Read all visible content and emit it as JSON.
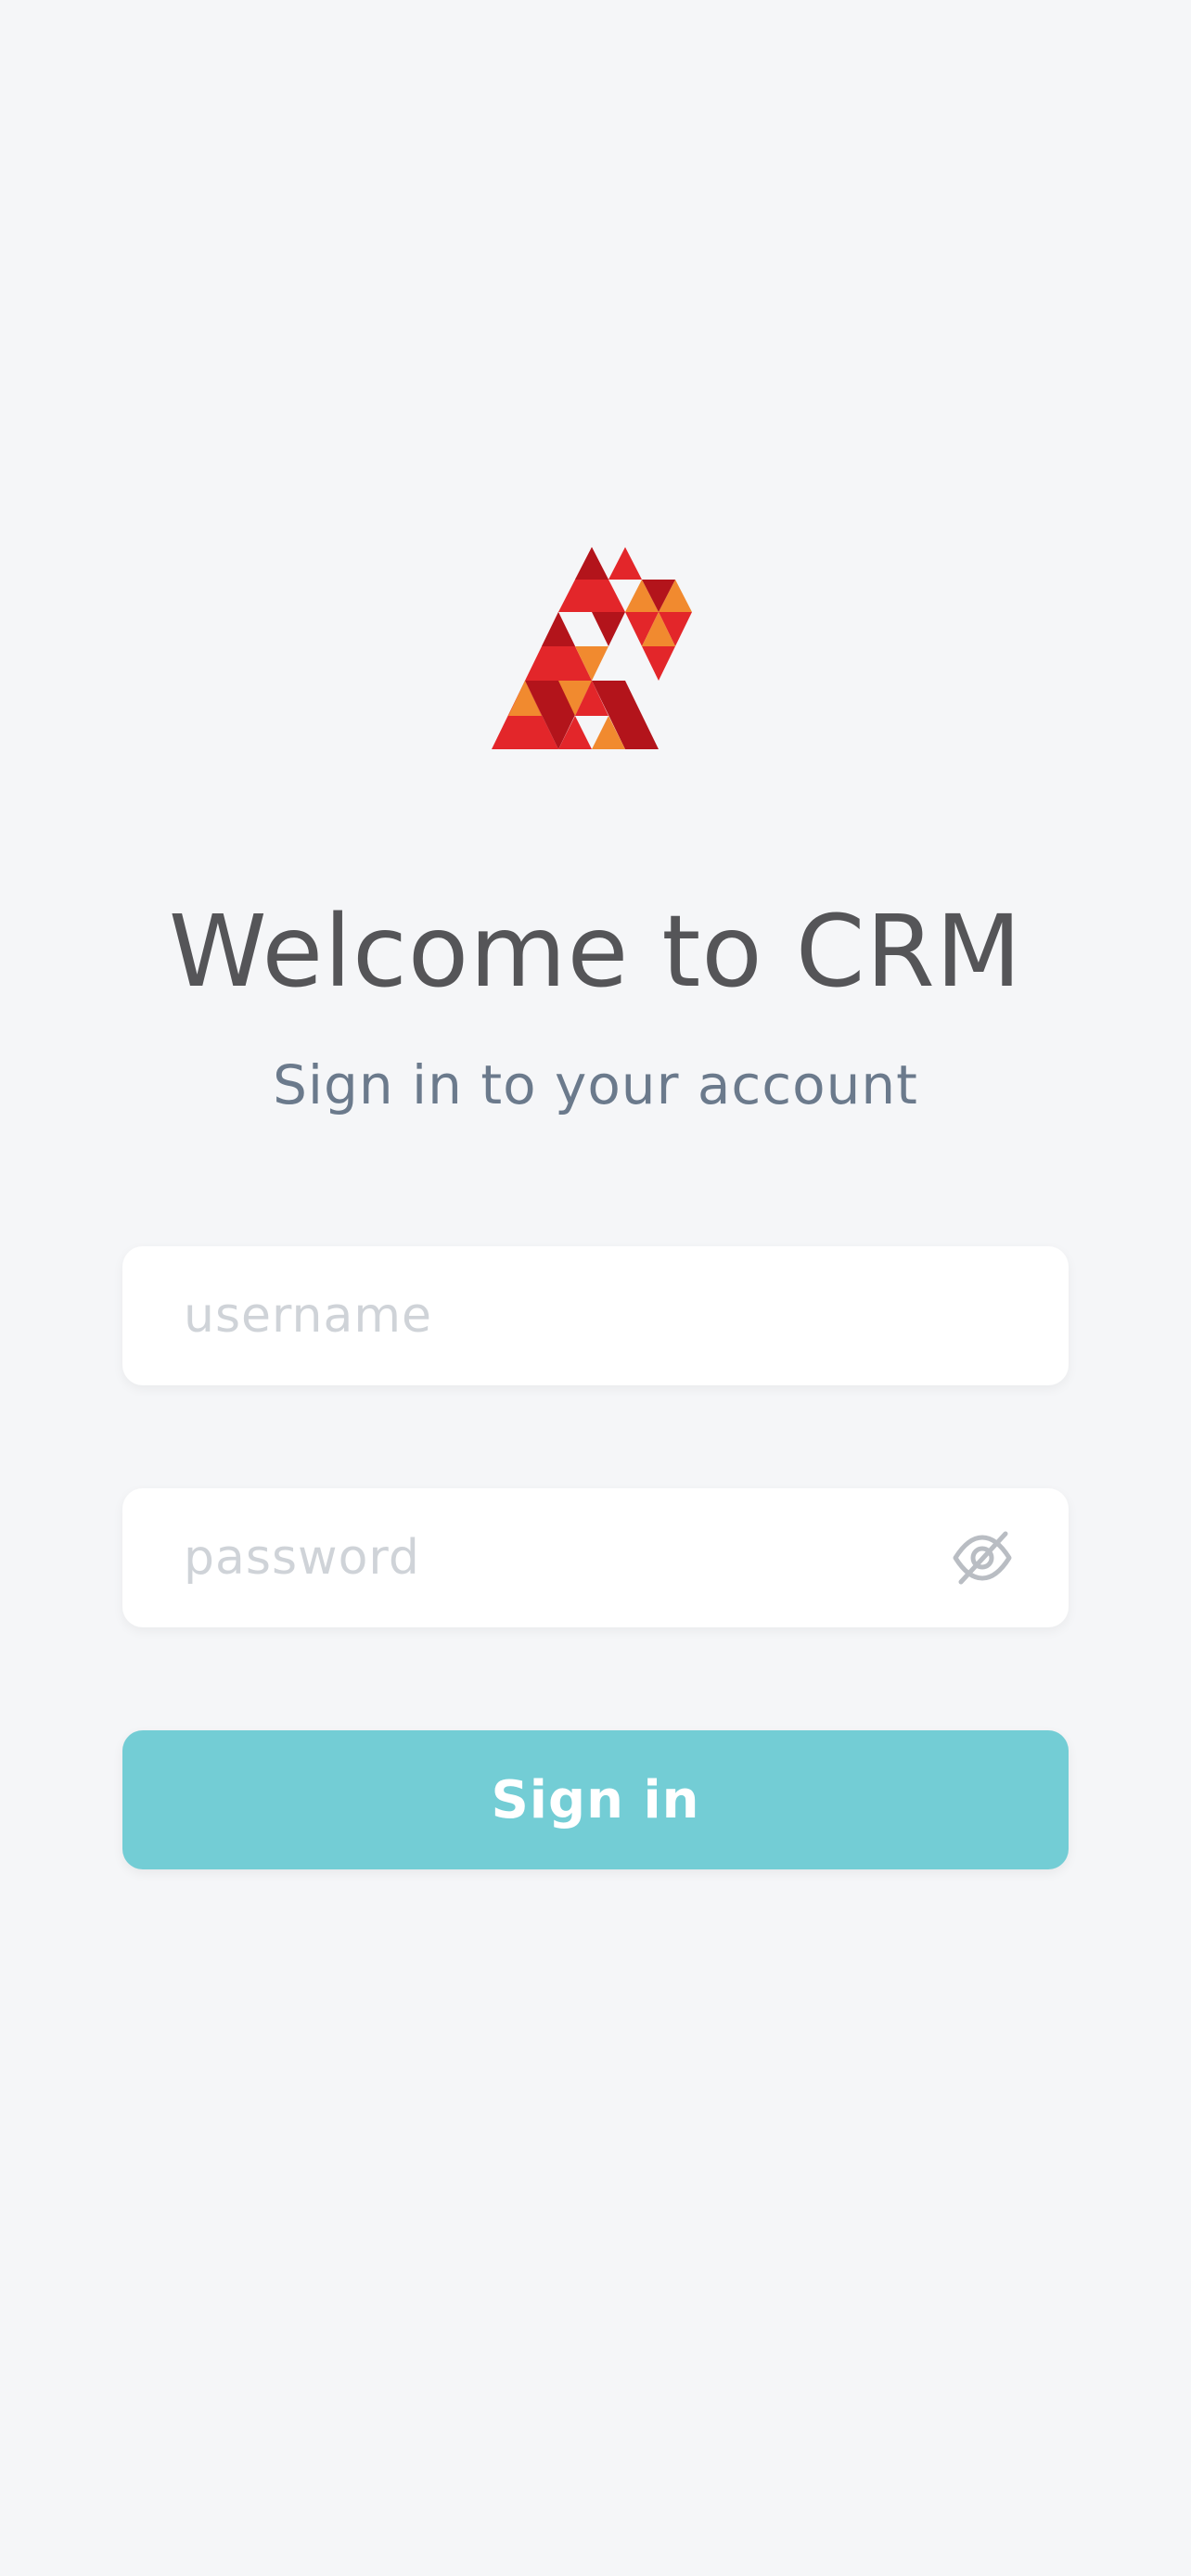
{
  "login": {
    "title": "Welcome to CRM",
    "subtitle": "Sign in to your account",
    "username_placeholder": "username",
    "username_value": "",
    "password_placeholder": "password",
    "password_value": "",
    "password_toggle_icon": "eye-off-icon",
    "submit_label": "Sign in"
  },
  "colors": {
    "background": "#f5f6f8",
    "accent": "#73cdd5",
    "logo_red": "#e3262a",
    "logo_dark_red": "#b3141b",
    "logo_orange": "#f18a2f"
  }
}
